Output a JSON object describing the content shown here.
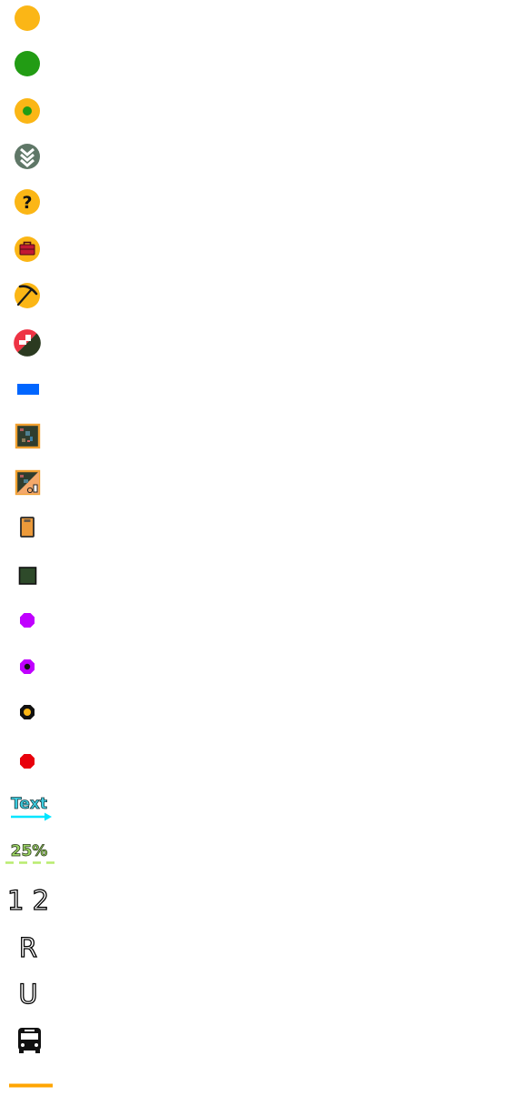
{
  "legend": {
    "text_sample": "Text",
    "percent_sample": "25%",
    "numbers_sample": "1 2",
    "letter_r": "R",
    "letter_u": "U"
  },
  "colors": {
    "yellow": "#fbb616",
    "green": "#229c14",
    "gray_green": "#5f7767",
    "red": "#e8000b",
    "blue": "#0066ff",
    "purple": "#c000ff",
    "cyan": "#00e5ff",
    "lime": "#b8ec6e",
    "orange": "#ffa500"
  },
  "icons": [
    "yellow-dot-icon",
    "green-dot-icon",
    "yellow-dot-green-center-icon",
    "double-chevron-down-icon",
    "question-mark-icon",
    "briefcase-icon",
    "pickaxe-icon",
    "half-red-half-green-circle-icon",
    "blue-rectangle-icon",
    "map-tile-icon",
    "map-tile-split-icon",
    "jar-icon",
    "dark-green-square-icon",
    "purple-octagon-icon",
    "purple-octagon-dot-icon",
    "yellow-ring-octagon-icon",
    "red-octagon-icon",
    "text-arrow-icon",
    "percent-dashed-icon",
    "numbers-icon",
    "letter-r-icon",
    "letter-u-icon",
    "bus-icon",
    "orange-line-icon"
  ]
}
